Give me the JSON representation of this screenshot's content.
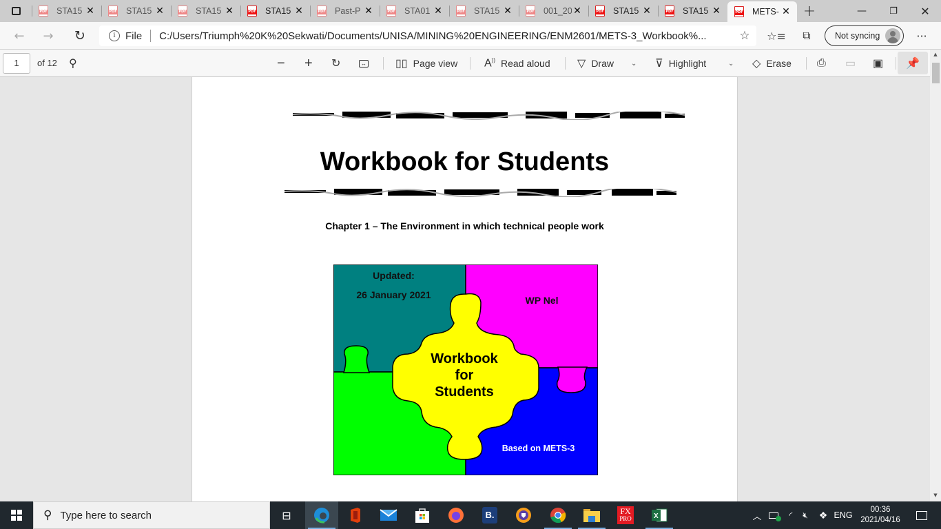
{
  "browser": {
    "tabs": [
      {
        "label": "STA15",
        "icon": "pdf-icon",
        "strong": false
      },
      {
        "label": "STA15",
        "icon": "pdf-icon",
        "strong": false
      },
      {
        "label": "STA15",
        "icon": "pdf-icon",
        "strong": false
      },
      {
        "label": "STA15",
        "icon": "pdf-icon",
        "strong": true
      },
      {
        "label": "Past-P",
        "icon": "pdf-icon",
        "strong": false
      },
      {
        "label": "STA01",
        "icon": "pdf-icon",
        "strong": false
      },
      {
        "label": "STA15",
        "icon": "pdf-icon",
        "strong": false
      },
      {
        "label": "001_20",
        "icon": "pdf-icon",
        "strong": false
      },
      {
        "label": "STA15",
        "icon": "pdf-icon",
        "strong": true
      },
      {
        "label": "STA15",
        "icon": "pdf-icon",
        "strong": true
      },
      {
        "label": "METS-",
        "icon": "pdf-icon",
        "strong": true,
        "active": true
      }
    ],
    "close_glyph": "✕",
    "new_tab_glyph": "+",
    "window_controls": {
      "minimize": "—",
      "restore": "❐",
      "close": "✕"
    },
    "address": {
      "scheme_label": "File",
      "url": "C:/Users/Triumph%20K%20Sekwati/Documents/UNISA/MINING%20ENGINEERING/ENM2601/METS-3_Workbook%..."
    },
    "sync_label": "Not syncing",
    "more_glyph": "···"
  },
  "pdf_toolbar": {
    "page_current": "1",
    "page_total_label": "of 12",
    "page_view_label": "Page view",
    "read_aloud_label": "Read aloud",
    "draw_label": "Draw",
    "highlight_label": "Highlight",
    "erase_label": "Erase"
  },
  "document": {
    "title": "Workbook for Students",
    "chapter": "Chapter 1 – The Environment in which technical people work",
    "puzzle": {
      "updated_label": "Updated:",
      "updated_date": "26 January 2021",
      "author": "WP Nel",
      "center_line1": "Workbook",
      "center_line2": "for",
      "center_line3": "Students",
      "based_on": "Based on METS-3",
      "colors": {
        "teal": "#008080",
        "magenta": "#ff00ff",
        "green": "#00ff00",
        "blue": "#0000ff",
        "yellow": "#ffff00"
      }
    }
  },
  "taskbar": {
    "search_placeholder": "Type here to search",
    "apps": [
      "task-view",
      "edge",
      "office",
      "mail",
      "store",
      "firefox",
      "booking",
      "vpn-browser",
      "chrome",
      "file-explorer",
      "fxpro",
      "excel"
    ],
    "fxpro_label_top": "FX",
    "fxpro_label_bottom": "PRO",
    "booking_label": "B.",
    "tray": {
      "language": "ENG",
      "time": "00:36",
      "date": "2021/04/16"
    }
  }
}
